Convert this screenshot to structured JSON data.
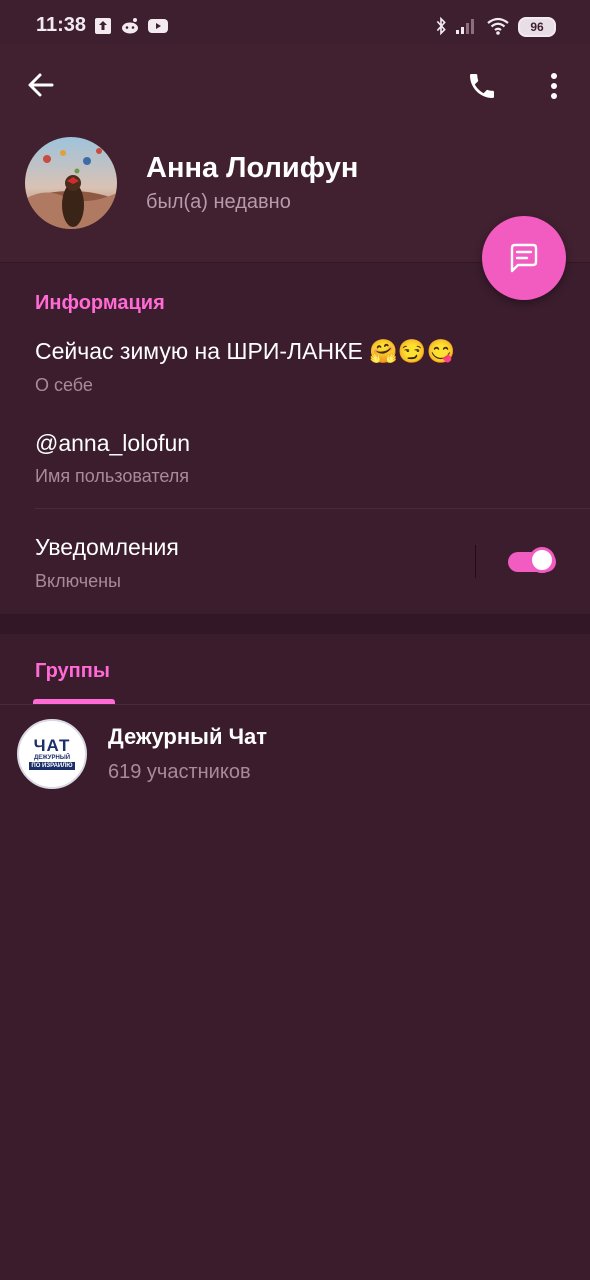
{
  "status_bar": {
    "time": "11:38",
    "battery": "96",
    "left_icons": [
      "upload-icon",
      "reddit-icon",
      "youtube-icon"
    ],
    "right_icons": [
      "bluetooth-icon",
      "signal-icon",
      "wifi-icon",
      "battery-icon"
    ]
  },
  "header": {
    "back_icon": "arrow-left-icon",
    "call_icon": "phone-icon",
    "menu_icon": "more-vert-icon",
    "name": "Анна Лолифун",
    "status": "был(а) недавно",
    "fab_icon": "message-icon"
  },
  "info": {
    "title": "Информация",
    "bio": "Сейчас зимую на ШРИ-ЛАНКЕ 🤗😏😋",
    "bio_label": "О себе",
    "username": "@anna_lolofun",
    "username_label": "Имя пользователя",
    "notifications": "Уведомления",
    "notifications_state": "Включены",
    "notifications_on": true
  },
  "groups": {
    "tab_label": "Группы",
    "items": [
      {
        "name": "Дежурный Чат",
        "members": "619 участников",
        "avatar_text_big": "ЧАТ",
        "avatar_text_small1": "ДЕЖУРНЫЙ",
        "avatar_text_small2": "ПО ИЗРАИЛЮ"
      }
    ]
  },
  "colors": {
    "accent": "#ff6ad5",
    "fab": "#f25cc1",
    "header_bg": "#41202f",
    "body_bg": "#3a1c2c"
  }
}
